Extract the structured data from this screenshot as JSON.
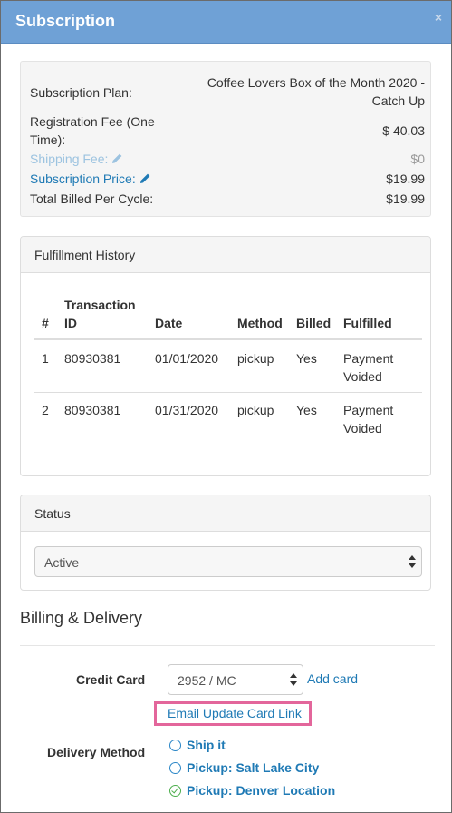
{
  "modal": {
    "title": "Subscription",
    "close_glyph": "×"
  },
  "summary": {
    "plan_label": "Subscription Plan:",
    "plan_value_line1": "Coffee Lovers Box of the Month 2020 -",
    "plan_value_line2": "Catch Up",
    "registration_label_line1": "Registration Fee (One",
    "registration_label_line2": "Time):",
    "registration_value": "$ 40.03",
    "shipping_label": "Shipping Fee:",
    "shipping_value": "$0",
    "price_label": "Subscription Price:",
    "price_value": "$19.99",
    "total_label": "Total Billed Per Cycle:",
    "total_value": "$19.99",
    "edit_icon": "pencil-icon"
  },
  "fulfillment": {
    "heading": "Fulfillment History",
    "columns": {
      "num": "#",
      "txn_line1": "Transaction",
      "txn_line2": "ID",
      "date": "Date",
      "method": "Method",
      "billed": "Billed",
      "fulfilled": "Fulfilled"
    },
    "rows": [
      {
        "num": "1",
        "txn": "80930381",
        "date": "01/01/2020",
        "method": "pickup",
        "billed": "Yes",
        "fulfilled_line1": "Payment",
        "fulfilled_line2": "Voided"
      },
      {
        "num": "2",
        "txn": "80930381",
        "date": "01/31/2020",
        "method": "pickup",
        "billed": "Yes",
        "fulfilled_line1": "Payment",
        "fulfilled_line2": "Voided"
      }
    ]
  },
  "status": {
    "heading": "Status",
    "selected": "Active"
  },
  "billing": {
    "heading": "Billing & Delivery",
    "credit_card_label": "Credit Card",
    "card_selected": "2952 / MC",
    "add_card": "Add card",
    "email_link": "Email Update Card Link",
    "delivery_label": "Delivery Method",
    "delivery_options": [
      {
        "label": "Ship it",
        "checked": false
      },
      {
        "label": "Pickup: Salt Lake City",
        "checked": false
      },
      {
        "label": "Pickup: Denver Location",
        "checked": true
      }
    ]
  },
  "colors": {
    "header": "#6fa1d6",
    "link": "#1f7ab5",
    "highlight": "#e3669b",
    "check": "#4cae4c"
  }
}
